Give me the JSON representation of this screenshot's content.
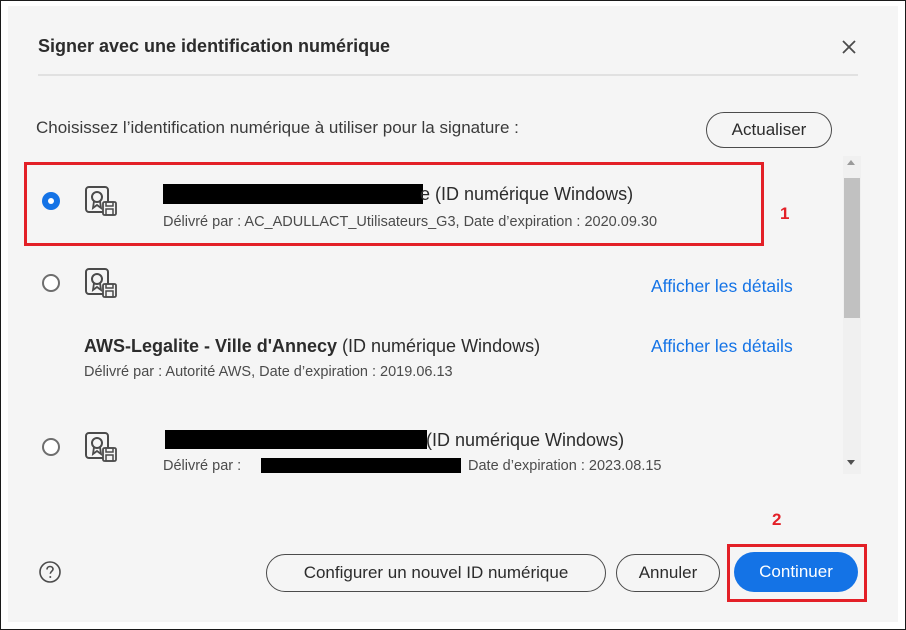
{
  "dialog": {
    "title": "Signer avec une identification numérique",
    "prompt": "Choisissez l’identification numérique à utiliser pour la signature :",
    "refresh_label": "Actualiser"
  },
  "ids": [
    {
      "selected": true,
      "name_suffix": "e (ID numérique Windows)",
      "issuer_line": "Délivré par : AC_ADULLACT_Utilisateurs_G3, Date d’expiration : 2020.09.30",
      "details_label": ""
    },
    {
      "selected": false,
      "details_label": "Afficher les détails"
    },
    {
      "selected": false,
      "name": "AWS-Legalite - Ville d'Annecy",
      "type": " (ID numérique Windows)",
      "issuer_line": "Délivré par : Autorité AWS, Date d’expiration : 2019.06.13",
      "details_label": "Afficher les détails"
    },
    {
      "selected": false,
      "name_suffix": "(ID numérique Windows)",
      "issuer_prefix": "Délivré par :",
      "issuer_suffix": "Date d’expiration : 2023.08.15"
    }
  ],
  "annotations": {
    "marker_1": "1",
    "marker_2": "2",
    "color": "#e32027"
  },
  "footer": {
    "configure_label": "Configurer un nouvel ID numérique",
    "cancel_label": "Annuler",
    "continue_label": "Continuer"
  },
  "colors": {
    "accent": "#1473e6",
    "dialog_bg": "#f5f5f5"
  },
  "icons": {
    "close": "close-icon",
    "certificate": "certificate-icon",
    "help": "help-icon"
  }
}
